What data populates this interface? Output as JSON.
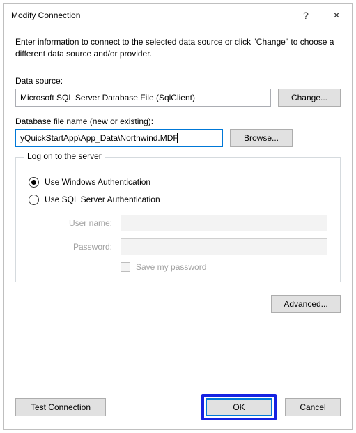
{
  "window": {
    "title": "Modify Connection",
    "help_glyph": "?",
    "close_glyph": "✕"
  },
  "intro": "Enter information to connect to the selected data source or click \"Change\" to choose a different data source and/or provider.",
  "data_source": {
    "label": "Data source:",
    "value": "Microsoft SQL Server Database File (SqlClient)",
    "change_button": "Change..."
  },
  "db_file": {
    "label": "Database file name (new or existing):",
    "value": "yQuickStartApp\\App_Data\\Northwind.MDF",
    "browse_button": "Browse..."
  },
  "logon": {
    "legend": "Log on to the server",
    "radio_windows": "Use Windows Authentication",
    "radio_sql": "Use SQL Server Authentication",
    "selected": "windows",
    "username_label": "User name:",
    "password_label": "Password:",
    "save_pw_label": "Save my password"
  },
  "buttons": {
    "advanced": "Advanced...",
    "test_connection": "Test Connection",
    "ok": "OK",
    "cancel": "Cancel"
  }
}
